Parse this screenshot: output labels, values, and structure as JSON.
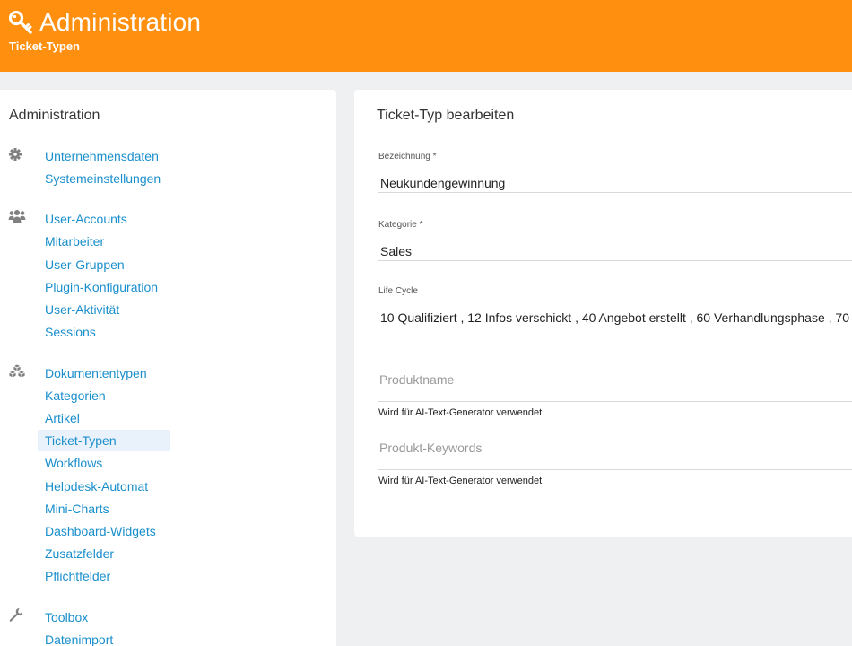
{
  "header": {
    "title": "Administration",
    "subtitle": "Ticket-Typen",
    "icon": "key-icon",
    "color": "#ff8f0f"
  },
  "sidebar": {
    "title": "Administration",
    "groups": [
      {
        "icon": "gear-icon",
        "items": [
          "Unternehmensdaten",
          "Systemeinstellungen"
        ]
      },
      {
        "icon": "users-icon",
        "items": [
          "User-Accounts",
          "Mitarbeiter",
          "User-Gruppen",
          "Plugin-Konfiguration",
          "User-Aktivität",
          "Sessions"
        ]
      },
      {
        "icon": "cubes-icon",
        "items": [
          "Dokumententypen",
          "Kategorien",
          "Artikel",
          "Ticket-Typen",
          "Workflows",
          "Helpdesk-Automat",
          "Mini-Charts",
          "Dashboard-Widgets",
          "Zusatzfelder",
          "Pflichtfelder"
        ]
      },
      {
        "icon": "wrench-icon",
        "items": [
          "Toolbox",
          "Datenimport"
        ]
      }
    ],
    "active_item": "Ticket-Typen",
    "link_color": "#1a8fcc"
  },
  "panel": {
    "title": "Ticket-Typ bearbeiten",
    "fields": {
      "bezeichnung": {
        "label": "Bezeichnung *",
        "value": "Neukundengewinnung"
      },
      "kategorie": {
        "label": "Kategorie *",
        "value": "Sales"
      },
      "lifecycle": {
        "label": "Life Cycle",
        "value": "10 Qualifiziert , 12 Infos verschickt , 40 Angebot erstellt , 60 Verhandlungsphase , 70"
      },
      "produktname": {
        "placeholder": "Produktname",
        "hint": "Wird für AI-Text-Generator verwendet"
      },
      "produktkeywords": {
        "placeholder": "Produkt-Keywords",
        "hint": "Wird für AI-Text-Generator verwendet"
      }
    }
  }
}
